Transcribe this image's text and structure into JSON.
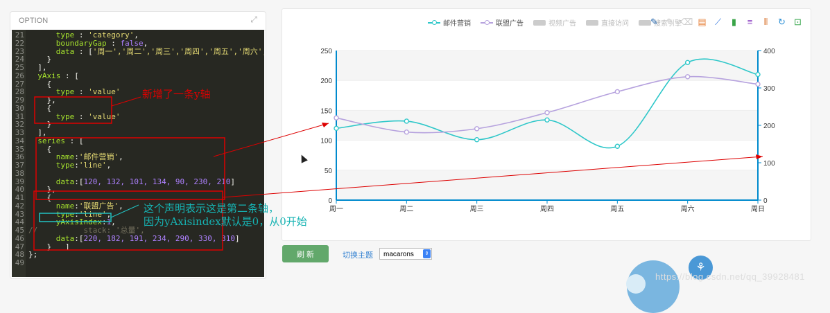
{
  "panel": {
    "title": "OPTION"
  },
  "code_lines": [
    {
      "n": "21",
      "segs": [
        [
          "k",
          "      type"
        ],
        [
          "p",
          " : "
        ],
        [
          "s",
          "'category'"
        ],
        [
          "p",
          ","
        ]
      ]
    },
    {
      "n": "22",
      "segs": [
        [
          "k",
          "      boundaryGap"
        ],
        [
          "p",
          " : "
        ],
        [
          "n",
          "false"
        ],
        [
          "p",
          ","
        ]
      ]
    },
    {
      "n": "23",
      "segs": [
        [
          "k",
          "      data"
        ],
        [
          "p",
          " : ["
        ],
        [
          "s",
          "'周一','周二','周三','周四','周五','周六','周日'"
        ],
        [
          "p",
          "]"
        ]
      ]
    },
    {
      "n": "24",
      "segs": [
        [
          "p",
          "    }"
        ]
      ]
    },
    {
      "n": "25",
      "segs": [
        [
          "p",
          "  ],"
        ]
      ]
    },
    {
      "n": "26",
      "segs": [
        [
          "k",
          "  yAxis"
        ],
        [
          "p",
          " : ["
        ]
      ]
    },
    {
      "n": "27",
      "segs": [
        [
          "p",
          "    {"
        ]
      ]
    },
    {
      "n": "28",
      "segs": [
        [
          "k",
          "      type"
        ],
        [
          "p",
          " : "
        ],
        [
          "s",
          "'value'"
        ]
      ]
    },
    {
      "n": "29",
      "segs": [
        [
          "p",
          "    },"
        ]
      ]
    },
    {
      "n": "30",
      "segs": [
        [
          "p",
          "    {"
        ]
      ]
    },
    {
      "n": "31",
      "segs": [
        [
          "k",
          "      type"
        ],
        [
          "p",
          " : "
        ],
        [
          "s",
          "'value'"
        ]
      ]
    },
    {
      "n": "32",
      "segs": [
        [
          "p",
          "    }"
        ]
      ]
    },
    {
      "n": "33",
      "segs": [
        [
          "p",
          "  ],"
        ]
      ]
    },
    {
      "n": "34",
      "segs": [
        [
          "k",
          "  series"
        ],
        [
          "p",
          " : ["
        ]
      ]
    },
    {
      "n": "35",
      "segs": [
        [
          "p",
          "    {"
        ]
      ]
    },
    {
      "n": "36",
      "segs": [
        [
          "k",
          "      name"
        ],
        [
          "p",
          ":"
        ],
        [
          "s",
          "'邮件营销'"
        ],
        [
          "p",
          ","
        ]
      ]
    },
    {
      "n": "37",
      "segs": [
        [
          "k",
          "      type"
        ],
        [
          "p",
          ":"
        ],
        [
          "s",
          "'line'"
        ],
        [
          "p",
          ","
        ]
      ]
    },
    {
      "n": "38",
      "segs": [
        [
          "p",
          ""
        ]
      ]
    },
    {
      "n": "39",
      "segs": [
        [
          "k",
          "      data"
        ],
        [
          "p",
          ":["
        ],
        [
          "n",
          "120, 132, 101, 134, 90, 230, 210"
        ],
        [
          "p",
          "]"
        ]
      ]
    },
    {
      "n": "40",
      "segs": [
        [
          "p",
          "    },"
        ]
      ]
    },
    {
      "n": "41",
      "segs": [
        [
          "p",
          "    {"
        ]
      ]
    },
    {
      "n": "42",
      "segs": [
        [
          "k",
          "      name"
        ],
        [
          "p",
          ":"
        ],
        [
          "s",
          "'联盟广告'"
        ],
        [
          "p",
          ","
        ]
      ]
    },
    {
      "n": "43",
      "segs": [
        [
          "k",
          "      type"
        ],
        [
          "p",
          ":"
        ],
        [
          "s",
          "'line'"
        ],
        [
          "p",
          ","
        ]
      ]
    },
    {
      "n": "44",
      "segs": [
        [
          "k",
          "      yAxisIndex"
        ],
        [
          "p",
          ":"
        ],
        [
          "n",
          "1"
        ],
        [
          "p",
          ","
        ]
      ]
    },
    {
      "n": "45",
      "segs": [
        [
          "c",
          "//          stack: '总量',"
        ]
      ]
    },
    {
      "n": "46",
      "segs": [
        [
          "k",
          "      data"
        ],
        [
          "p",
          ":["
        ],
        [
          "n",
          "220, 182, 191, 234, 290, 330, 310"
        ],
        [
          "p",
          "]"
        ]
      ]
    },
    {
      "n": "47",
      "segs": [
        [
          "p",
          "    }   ]"
        ]
      ]
    },
    {
      "n": "48",
      "segs": [
        [
          "p",
          "};"
        ]
      ]
    },
    {
      "n": "49",
      "segs": [
        [
          "p",
          ""
        ]
      ]
    }
  ],
  "annotations": {
    "new_axis": "新增了一条y轴",
    "second_axis_1": "这个声明表示这是第二条轴，",
    "second_axis_2": "因为yAxisindex默认是0，从0开始"
  },
  "legend": [
    {
      "name": "邮件营销",
      "color": "#2ec7c9",
      "active": true
    },
    {
      "name": "联盟广告",
      "color": "#b6a2de",
      "active": true
    },
    {
      "name": "视频广告",
      "color": "#cccccc",
      "active": false
    },
    {
      "name": "直接访问",
      "color": "#cccccc",
      "active": false
    },
    {
      "name": "搜索引擎",
      "color": "#cccccc",
      "active": false
    }
  ],
  "toolbar": [
    {
      "name": "mark-icon",
      "glyph": "✎",
      "color": "#2b6cb0"
    },
    {
      "name": "mark-undo-icon",
      "glyph": "✎",
      "color": "#ccc"
    },
    {
      "name": "mark-clear-icon",
      "glyph": "⌫",
      "color": "#ccc"
    },
    {
      "name": "data-view-icon",
      "glyph": "▤",
      "color": "#e6813b"
    },
    {
      "name": "line-chart-icon",
      "glyph": "⟋",
      "color": "#3a7be0"
    },
    {
      "name": "bar-chart-icon",
      "glyph": "▮",
      "color": "#38a447"
    },
    {
      "name": "stack-icon",
      "glyph": "≡",
      "color": "#8b3fc2"
    },
    {
      "name": "tiled-icon",
      "glyph": "⦀",
      "color": "#d9732d"
    },
    {
      "name": "restore-icon",
      "glyph": "↻",
      "color": "#2b8fd6"
    },
    {
      "name": "save-image-icon",
      "glyph": "⊡",
      "color": "#3aa84f"
    }
  ],
  "chart_data": {
    "type": "line",
    "categories": [
      "周一",
      "周二",
      "周三",
      "周四",
      "周五",
      "周六",
      "周日"
    ],
    "series": [
      {
        "name": "邮件营销",
        "values": [
          120,
          132,
          101,
          134,
          90,
          230,
          210
        ],
        "color": "#2ec7c9",
        "yAxisIndex": 0
      },
      {
        "name": "联盟广告",
        "values": [
          220,
          182,
          191,
          234,
          290,
          330,
          310
        ],
        "color": "#b6a2de",
        "yAxisIndex": 1
      }
    ],
    "y_left": {
      "ticks": [
        0,
        50,
        100,
        150,
        200,
        250
      ],
      "ylim": [
        0,
        250
      ]
    },
    "y_right": {
      "ticks": [
        0,
        100,
        200,
        300,
        400
      ],
      "ylim": [
        0,
        400
      ]
    }
  },
  "controls": {
    "refresh_label": "刷 新",
    "theme_label": "切换主题",
    "theme_value": "macarons"
  },
  "watermark": "https://blog.csdn.net/qq_39928481"
}
